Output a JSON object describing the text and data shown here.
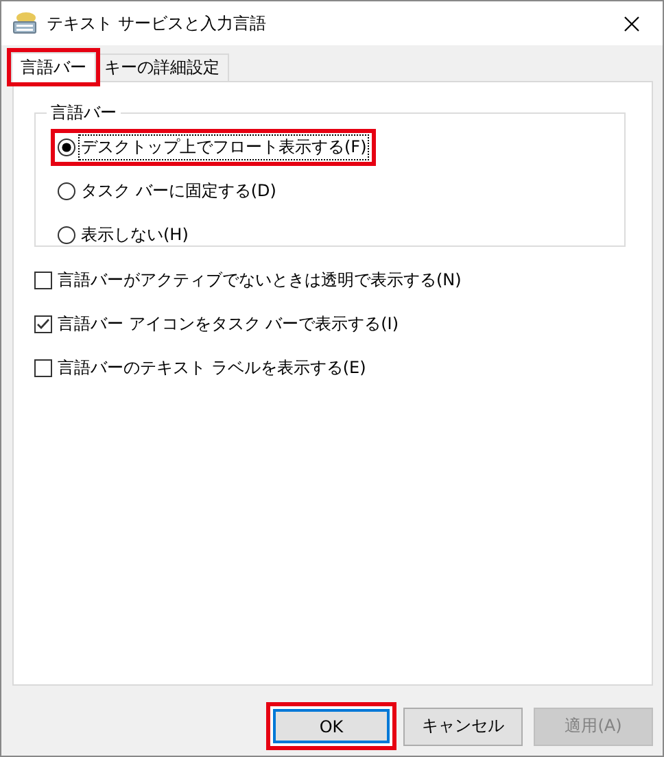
{
  "window": {
    "title": "テキスト サービスと入力言語"
  },
  "tabs": [
    {
      "label": "言語バー",
      "selected": true,
      "highlighted": true
    },
    {
      "label": "キーの詳細設定",
      "selected": false,
      "highlighted": false
    }
  ],
  "group": {
    "title": "言語バー",
    "options": [
      {
        "label": "デスクトップ上でフロート表示する(F)",
        "selected": true,
        "focused": true,
        "highlighted": true
      },
      {
        "label": "タスク バーに固定する(D)",
        "selected": false,
        "focused": false,
        "highlighted": false
      },
      {
        "label": "表示しない(H)",
        "selected": false,
        "focused": false,
        "highlighted": false
      }
    ]
  },
  "checkboxes": [
    {
      "label": "言語バーがアクティブでないときは透明で表示する(N)",
      "checked": false
    },
    {
      "label": "言語バー アイコンをタスク バーで表示する(I)",
      "checked": true
    },
    {
      "label": "言語バーのテキスト ラベルを表示する(E)",
      "checked": false
    }
  ],
  "buttons": [
    {
      "label": "OK",
      "default": true,
      "disabled": false,
      "highlighted": true
    },
    {
      "label": "キャンセル",
      "default": false,
      "disabled": false,
      "highlighted": false
    },
    {
      "label": "適用(A)",
      "default": false,
      "disabled": true,
      "highlighted": false
    }
  ]
}
